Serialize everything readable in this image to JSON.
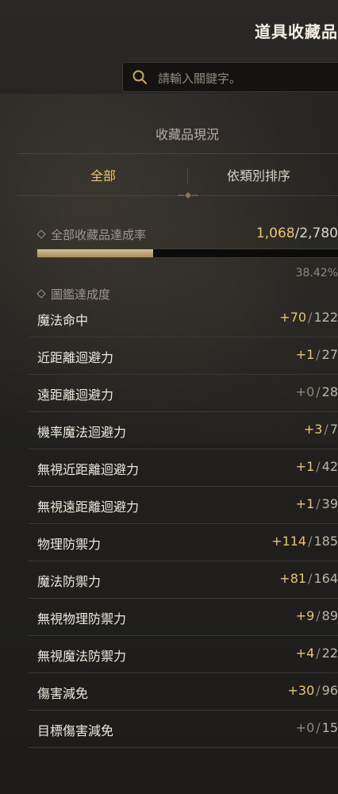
{
  "window": {
    "title": "道具收藏品"
  },
  "search": {
    "placeholder": "請輸入關鍵字。"
  },
  "status_title": "收藏品現況",
  "tabs": [
    {
      "label": "全部",
      "active": true
    },
    {
      "label": "依類別排序",
      "active": false
    }
  ],
  "overall": {
    "label": "全部收藏品達成率",
    "current": "1,068",
    "max": "2,780",
    "progress_fraction": 0.3842,
    "percent": "38.42%"
  },
  "codex": {
    "label": "圖鑑達成度"
  },
  "stats": [
    {
      "name": "魔法命中",
      "current": "+70",
      "max": "122"
    },
    {
      "name": "近距離迴避力",
      "current": "+1",
      "max": "27"
    },
    {
      "name": "遠距離迴避力",
      "current": "+0",
      "max": "28"
    },
    {
      "name": "機率魔法迴避力",
      "current": "+3",
      "max": "7"
    },
    {
      "name": "無視近距離迴避力",
      "current": "+1",
      "max": "42"
    },
    {
      "name": "無視遠距離迴避力",
      "current": "+1",
      "max": "39"
    },
    {
      "name": "物理防禦力",
      "current": "+114",
      "max": "185"
    },
    {
      "name": "魔法防禦力",
      "current": "+81",
      "max": "164"
    },
    {
      "name": "無視物理防禦力",
      "current": "+9",
      "max": "89"
    },
    {
      "name": "無視魔法防禦力",
      "current": "+4",
      "max": "22"
    },
    {
      "name": "傷害減免",
      "current": "+30",
      "max": "96"
    },
    {
      "name": "目標傷害減免",
      "current": "+0",
      "max": "15"
    }
  ],
  "colors": {
    "accent_gold": "#e8c56f",
    "bar_fill": "#c9ae82"
  }
}
